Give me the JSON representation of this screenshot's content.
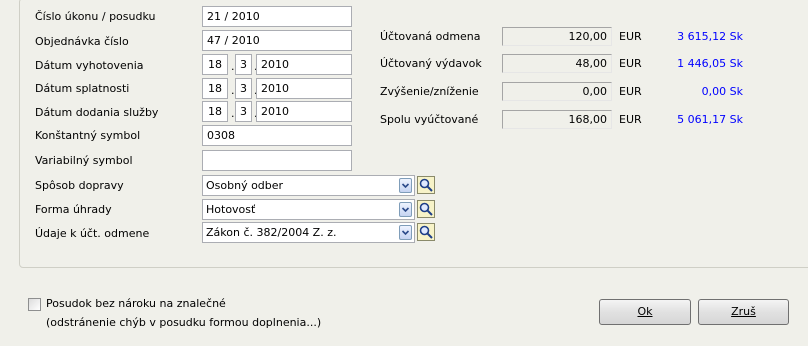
{
  "form": {
    "fields": [
      {
        "label": "Číslo úkonu / posudku",
        "value": "21 / 2010"
      },
      {
        "label": "Objednávka číslo",
        "value": "47 / 2010"
      },
      {
        "label": "Dátum vyhotovenia",
        "day": "18",
        "month": "3",
        "year": "2010"
      },
      {
        "label": "Dátum splatnosti",
        "day": "18",
        "month": "3",
        "year": "2010"
      },
      {
        "label": "Dátum dodania služby",
        "day": "18",
        "month": "3",
        "year": "2010"
      },
      {
        "label": "Konštantný symbol",
        "value": "0308"
      },
      {
        "label": "Variabilný symbol",
        "value": ""
      },
      {
        "label": "Spôsob dopravy",
        "value": "Osobný odber"
      },
      {
        "label": "Forma úhrady",
        "value": "Hotovosť"
      },
      {
        "label": "Údaje k účt. odmene",
        "value": "Zákon č. 382/2004 Z. z."
      }
    ],
    "date_separator": "."
  },
  "summary": [
    {
      "label": "Účtovaná odmena",
      "value": "120,00",
      "currency": "EUR",
      "sk": "3 615,12 Sk"
    },
    {
      "label": "Účtovaný výdavok",
      "value": "48,00",
      "currency": "EUR",
      "sk": "1 446,05 Sk"
    },
    {
      "label": "Zvýšenie/zníženie",
      "value": "0,00",
      "currency": "EUR",
      "sk": "0,00 Sk"
    },
    {
      "label": "Spolu vyúčtované",
      "value": "168,00",
      "currency": "EUR",
      "sk": "5 061,17 Sk"
    }
  ],
  "footer": {
    "checkbox_label": "Posudok bez nároku na znalečné",
    "checkbox_checked": false,
    "note": "(odstránenie chýb v posudku formou doplnenia...)",
    "ok_label": "Ok",
    "cancel_label": "Zruš"
  },
  "colors": {
    "sk_value": "#0000ff",
    "lookup_icon": "#f7f3c8"
  },
  "icons": {
    "dropdown": "chevron-down-icon",
    "lookup": "magnifier-icon"
  }
}
